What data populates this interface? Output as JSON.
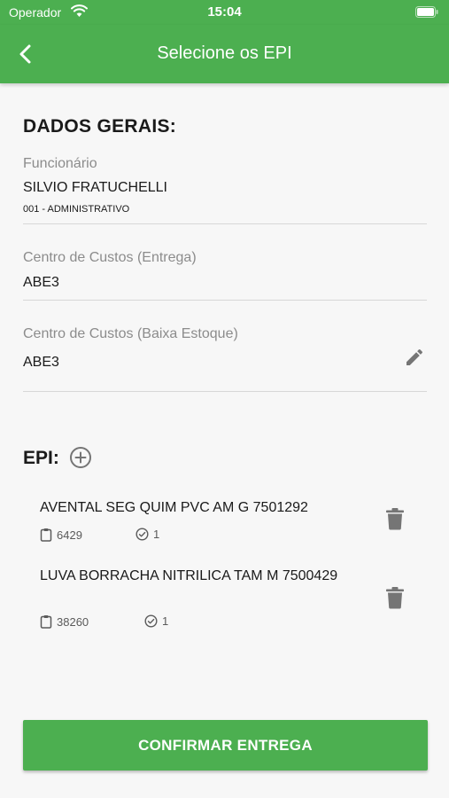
{
  "status_bar": {
    "carrier": "Operador",
    "time": "15:04"
  },
  "header": {
    "title": "Selecione os EPI",
    "back_icon": "chevron-left-icon"
  },
  "general": {
    "section_title": "DADOS GERAIS:",
    "employee_label": "Funcionário",
    "employee_name": "SILVIO FRATUCHELLI",
    "employee_department": "001 - ADMINISTRATIVO",
    "cost_center_delivery_label": "Centro de Custos (Entrega)",
    "cost_center_delivery_value": "ABE3",
    "cost_center_stock_label": "Centro de Custos (Baixa Estoque)",
    "cost_center_stock_value": "ABE3"
  },
  "epi": {
    "section_title": "EPI:",
    "items": [
      {
        "name": "AVENTAL SEG QUIM PVC AM G 7501292",
        "code": "6429",
        "quantity": "1"
      },
      {
        "name": "LUVA BORRACHA NITRILICA TAM M 7500429",
        "code": "38260",
        "quantity": "1"
      }
    ]
  },
  "actions": {
    "confirm_label": "CONFIRMAR ENTREGA"
  },
  "colors": {
    "primary": "#4caf50",
    "background": "#f7f7f7",
    "icon_gray": "#757575"
  }
}
